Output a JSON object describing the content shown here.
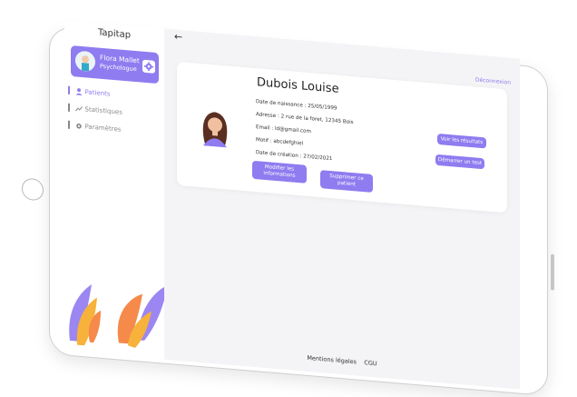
{
  "app": {
    "title": "Tapitap"
  },
  "user": {
    "name": "Flora Mallet",
    "role": "Psychologue"
  },
  "nav": [
    {
      "label": "Patients"
    },
    {
      "label": "Statistiques"
    },
    {
      "label": "Paramètres"
    }
  ],
  "header": {
    "back": "←",
    "logout": "Déconnexion"
  },
  "patient": {
    "name": "Dubois Louise",
    "fields": [
      "Date de naissance : 25/05/1999",
      "Adresse : 2 rue de la foret, 12345 Bois",
      "Email : ld@gmail.com",
      "Motif : abcdefghiel",
      "Date de création : 27/02/2021"
    ]
  },
  "actions": {
    "modify": "Modifier les informations",
    "delete": "Supprimer ce patient",
    "results": "Voir les résultats",
    "start_test": "Démarrer un test"
  },
  "footer": {
    "legal": "Mentions légales",
    "cgu": "CGU"
  },
  "colors": {
    "accent": "#8e7cf0"
  },
  "icons": [
    "user-icon",
    "chart-icon",
    "gear-icon",
    "back-arrow-icon"
  ]
}
